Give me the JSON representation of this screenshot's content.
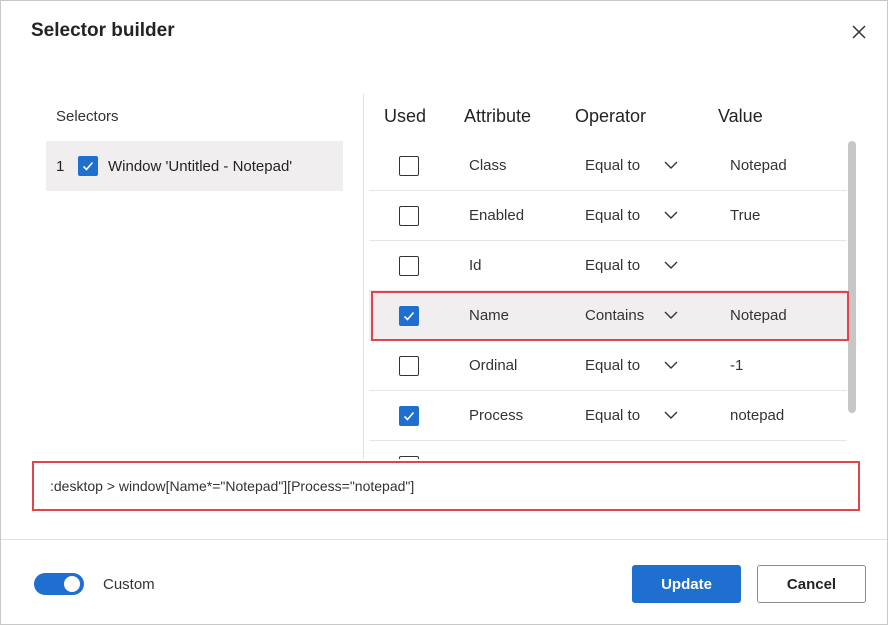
{
  "dialog": {
    "title": "Selector builder"
  },
  "selectors": {
    "label": "Selectors",
    "items": [
      {
        "index": "1",
        "label": "Window 'Untitled - Notepad'",
        "checked": true
      }
    ]
  },
  "table": {
    "headers": {
      "used": "Used",
      "attribute": "Attribute",
      "operator": "Operator",
      "value": "Value"
    },
    "rows": [
      {
        "attribute": "Class",
        "operator": "Equal to",
        "value": "Notepad",
        "used": false
      },
      {
        "attribute": "Enabled",
        "operator": "Equal to",
        "value": "True",
        "used": false
      },
      {
        "attribute": "Id",
        "operator": "Equal to",
        "value": "",
        "used": false
      },
      {
        "attribute": "Name",
        "operator": "Contains",
        "value": "Notepad",
        "used": true
      },
      {
        "attribute": "Ordinal",
        "operator": "Equal to",
        "value": "-1",
        "used": false
      },
      {
        "attribute": "Process",
        "operator": "Equal to",
        "value": "notepad",
        "used": true
      },
      {
        "attribute": "",
        "operator": "",
        "value": "",
        "used": false
      }
    ]
  },
  "selector_text": ":desktop > window[Name*=\"Notepad\"][Process=\"notepad\"]",
  "footer": {
    "custom_label": "Custom",
    "custom_on": true,
    "update_label": "Update",
    "cancel_label": "Cancel"
  },
  "colors": {
    "accent": "#1f6fd1",
    "highlight": "#e5424a",
    "selected_row": "#f0eeee"
  }
}
